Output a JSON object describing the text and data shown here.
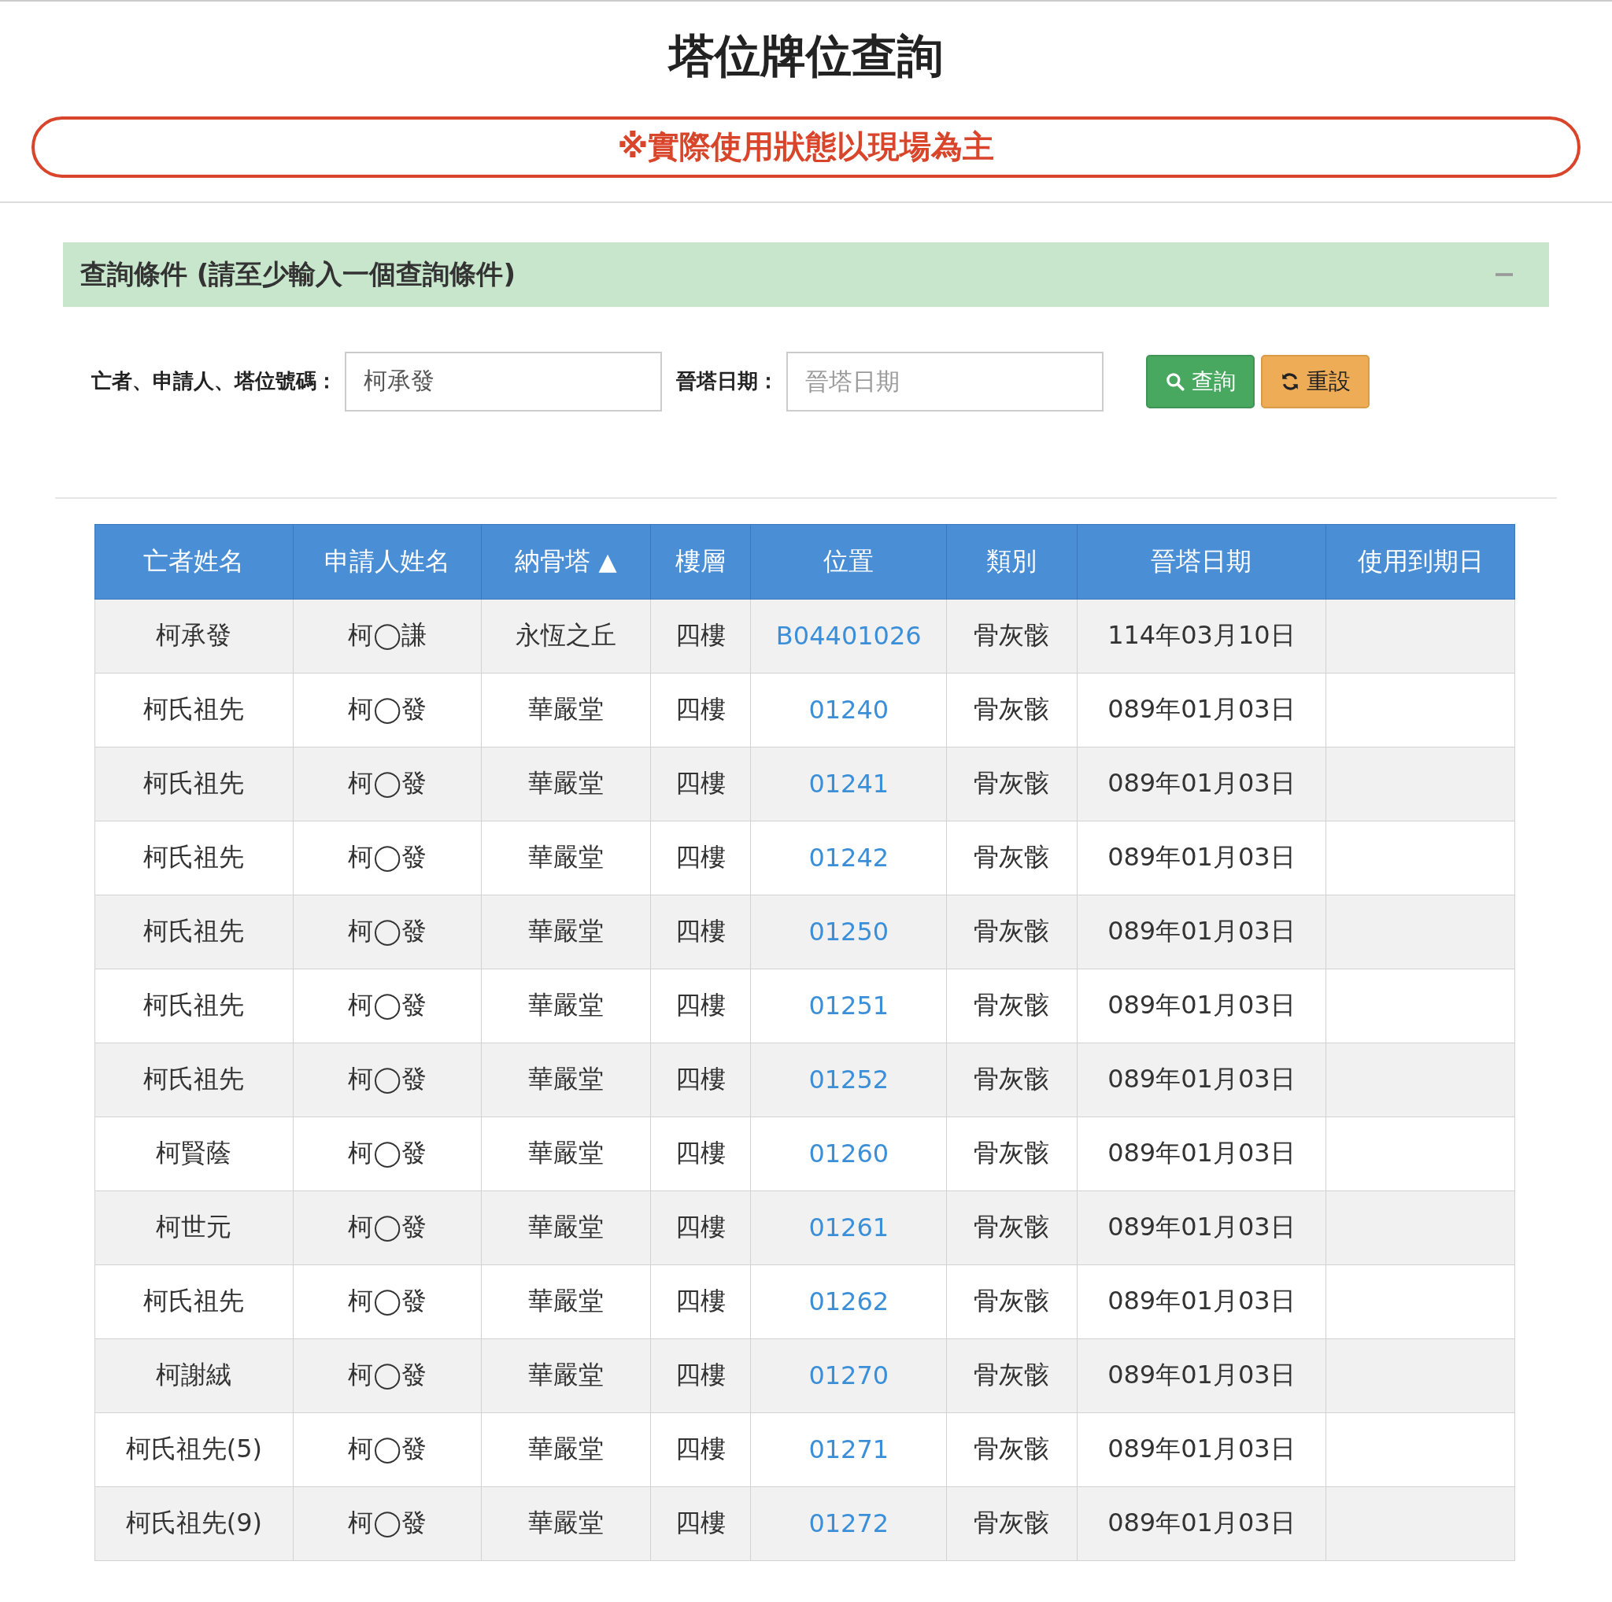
{
  "page_title": "塔位牌位查詢",
  "notice": "※實際使用狀態以現場為主",
  "search_panel": {
    "title": "查詢條件 (請至少輸入一個查詢條件)",
    "expanded": true,
    "fields": [
      {
        "label": "亡者、申請人、塔位號碼：",
        "value": "柯承發"
      },
      {
        "label": "晉塔日期：",
        "placeholder": "晉塔日期"
      }
    ],
    "buttons": [
      {
        "label": "查詢",
        "kind": "search"
      },
      {
        "label": "重設",
        "kind": "reset"
      }
    ]
  },
  "table": {
    "columns": [
      {
        "label": "亡者姓名"
      },
      {
        "label": "申請人姓名"
      },
      {
        "label": "納骨塔",
        "sort": "▲"
      },
      {
        "label": "樓層"
      },
      {
        "label": "位置"
      },
      {
        "label": "類別"
      },
      {
        "label": "晉塔日期"
      },
      {
        "label": "使用到期日"
      }
    ],
    "rows": [
      [
        "柯承發",
        "柯◯謙",
        "永恆之丘",
        "四樓",
        "B04401026",
        "骨灰骸",
        "114年03月10日",
        null
      ],
      [
        "柯氏祖先",
        "柯◯發",
        "華嚴堂",
        "四樓",
        "01240",
        "骨灰骸",
        "089年01月03日",
        null
      ],
      [
        "柯氏祖先",
        "柯◯發",
        "華嚴堂",
        "四樓",
        "01241",
        "骨灰骸",
        "089年01月03日",
        null
      ],
      [
        "柯氏祖先",
        "柯◯發",
        "華嚴堂",
        "四樓",
        "01242",
        "骨灰骸",
        "089年01月03日",
        null
      ],
      [
        "柯氏祖先",
        "柯◯發",
        "華嚴堂",
        "四樓",
        "01250",
        "骨灰骸",
        "089年01月03日",
        null
      ],
      [
        "柯氏祖先",
        "柯◯發",
        "華嚴堂",
        "四樓",
        "01251",
        "骨灰骸",
        "089年01月03日",
        null
      ],
      [
        "柯氏祖先",
        "柯◯發",
        "華嚴堂",
        "四樓",
        "01252",
        "骨灰骸",
        "089年01月03日",
        null
      ],
      [
        "柯賢蔭",
        "柯◯發",
        "華嚴堂",
        "四樓",
        "01260",
        "骨灰骸",
        "089年01月03日",
        null
      ],
      [
        "柯世元",
        "柯◯發",
        "華嚴堂",
        "四樓",
        "01261",
        "骨灰骸",
        "089年01月03日",
        null
      ],
      [
        "柯氏祖先",
        "柯◯發",
        "華嚴堂",
        "四樓",
        "01262",
        "骨灰骸",
        "089年01月03日",
        null
      ],
      [
        "柯謝絨",
        "柯◯發",
        "華嚴堂",
        "四樓",
        "01270",
        "骨灰骸",
        "089年01月03日",
        null
      ],
      [
        "柯氏祖先(5)",
        "柯◯發",
        "華嚴堂",
        "四樓",
        "01271",
        "骨灰骸",
        "089年01月03日",
        null
      ],
      [
        "柯氏祖先(9)",
        "柯◯發",
        "華嚴堂",
        "四樓",
        "01272",
        "骨灰骸",
        "089年01月03日",
        null
      ]
    ]
  }
}
